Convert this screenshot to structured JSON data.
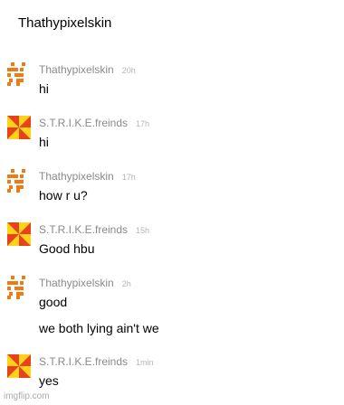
{
  "header": {
    "title": "Thathypixelskin"
  },
  "messages": [
    {
      "avatar": "pixel-creeper-avatar",
      "username": "Thathypixelskin",
      "time": "20h",
      "lines": [
        "hi"
      ]
    },
    {
      "avatar": "yellow-red-pinwheel-avatar",
      "username": "S.T.R.I.K.E.freinds",
      "time": "17h",
      "lines": [
        "hi"
      ]
    },
    {
      "avatar": "pixel-creeper-avatar",
      "username": "Thathypixelskin",
      "time": "17h",
      "lines": [
        "how r u?"
      ]
    },
    {
      "avatar": "yellow-red-pinwheel-avatar",
      "username": "S.T.R.I.K.E.freinds",
      "time": "15h",
      "lines": [
        "Good hbu"
      ]
    },
    {
      "avatar": "pixel-creeper-avatar",
      "username": "Thathypixelskin",
      "time": "2h",
      "lines": [
        "good",
        "we both lying ain't we"
      ]
    },
    {
      "avatar": "yellow-red-pinwheel-avatar",
      "username": "S.T.R.I.K.E.freinds",
      "time": "1min",
      "lines": [
        "yes"
      ]
    }
  ],
  "watermark": "imgflip.com",
  "colors": {
    "pixel_avatar": "#f07a14",
    "pinwheel_yellow": "#ffd21a",
    "pinwheel_red": "#e8421c",
    "username": "#8a8a8a",
    "timestamp": "#b5b5b5"
  }
}
